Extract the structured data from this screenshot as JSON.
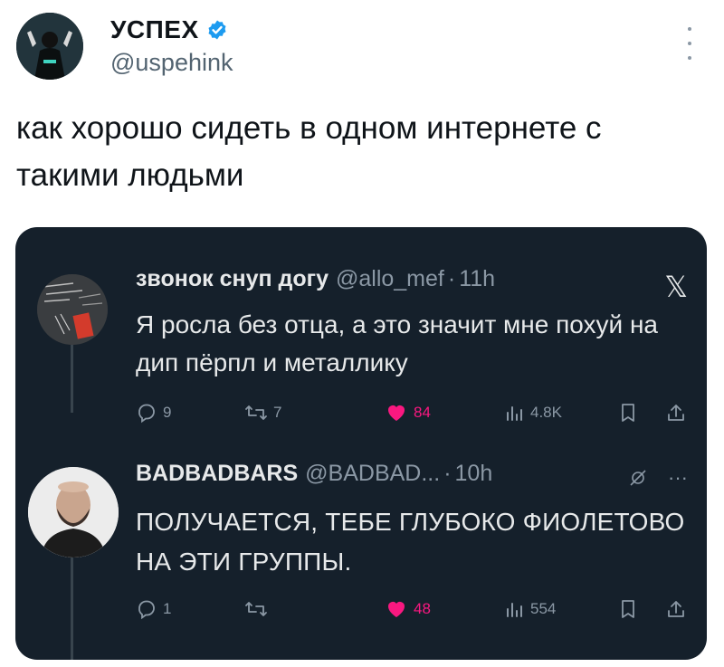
{
  "author": {
    "display_name": "УСПЕХ",
    "handle": "@uspehink",
    "verified": true
  },
  "tweet": {
    "text": "как хорошо сидеть в одном интернете с такими людьми"
  },
  "quoted_thread": {
    "posts": [
      {
        "name": "звонок снуп догу",
        "handle": "@allo_mef",
        "separator": "·",
        "time": "11h",
        "text": "Я росла без отца, а это значит мне похуй на дип пёрпл и металлику",
        "replies": "9",
        "reposts": "7",
        "likes": "84",
        "views": "4.8K"
      },
      {
        "name": "BADBADBARS",
        "handle": "@BADBAD...",
        "separator": "·",
        "time": "10h",
        "text": "ПОЛУЧАЕТСЯ, ТЕБЕ ГЛУБОКО ФИОЛЕТОВО НА ЭТИ ГРУППЫ.",
        "replies": "1",
        "reposts": "",
        "likes": "48",
        "views": "554",
        "more": "···"
      }
    ]
  },
  "colors": {
    "card_bg": "#15202b",
    "like": "#f91880",
    "verified": "#1d9bf0",
    "muted": "#8b98a5"
  }
}
